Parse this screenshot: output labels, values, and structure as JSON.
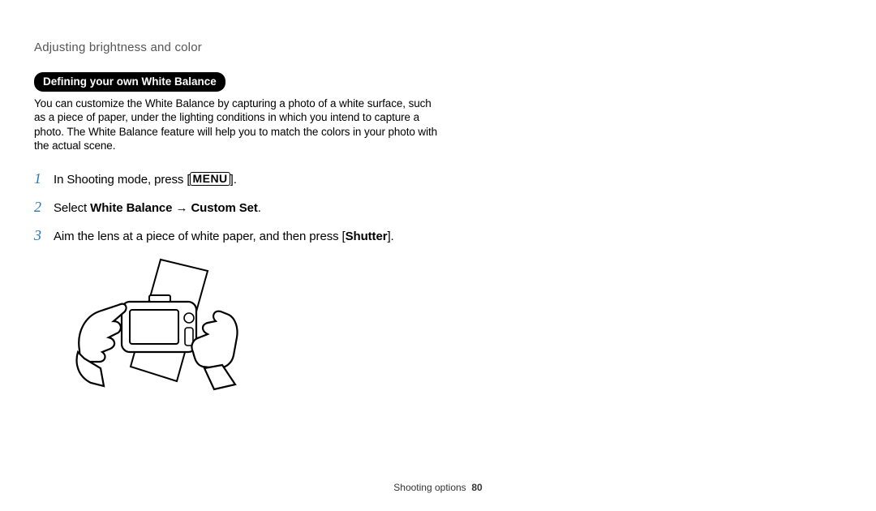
{
  "header": {
    "breadcrumb": "Adjusting brightness and color"
  },
  "section": {
    "label": "Defining your own White Balance",
    "body": "You can customize the White Balance by capturing a photo of a white surface, such as a piece of paper, under the lighting conditions in which you intend to capture a photo. The White Balance feature will help you to match the colors in your photo with the actual scene."
  },
  "steps": [
    {
      "num": "1",
      "pre": "In Shooting mode, press [",
      "menu_token": "MENU",
      "post": "]."
    },
    {
      "num": "2",
      "pre": "Select ",
      "bold1": "White Balance",
      "arrow": " → ",
      "bold2": "Custom Set",
      "post": "."
    },
    {
      "num": "3",
      "pre": "Aim the lens at a piece of white paper, and then press [",
      "bold1": "Shutter",
      "post": "]."
    }
  ],
  "footer": {
    "section": "Shooting options",
    "page": "80"
  }
}
